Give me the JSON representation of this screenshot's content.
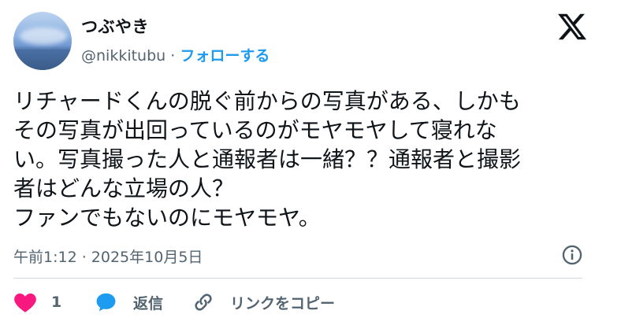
{
  "tweet": {
    "display_name": "つぶやき",
    "handle": "@nikkitubu",
    "separator": " · ",
    "follow_label": "フォローする",
    "text_lines": [
      "リチャードくんの脱ぐ前からの写真がある、しかも",
      "その写真が出回っているのがモヤモヤして寝れな",
      "い。写真撮った人と通報者は一緒？？通報者と撮影",
      "者はどんな立場の人？",
      "ファンでもないのにモヤモヤ。"
    ],
    "timestamp": "午前1:12 · 2025年10月5日"
  },
  "actions": {
    "like_count": "1",
    "reply_label": "返信",
    "copy_link_label": "リンクをコピー"
  },
  "icons": {
    "brand": "x-logo-icon",
    "info": "info-icon",
    "like": "heart-icon",
    "reply": "speech-bubble-icon",
    "copy_link": "link-icon"
  },
  "colors": {
    "accent": "#1d9bf0",
    "like": "#f91880",
    "secondary_text": "#536471",
    "divider": "#cfd9de"
  }
}
